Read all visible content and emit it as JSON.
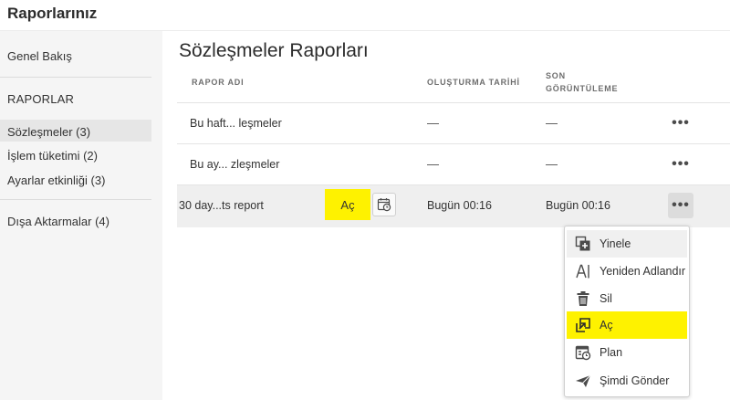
{
  "app": {
    "title": "Raporlarınız"
  },
  "sidebar": {
    "overview": "Genel Bakış",
    "section": "RAPORLAR",
    "items": [
      {
        "label": "Sözleşmeler (3)",
        "selected": true
      },
      {
        "label": "İşlem tüketimi (2)",
        "selected": false
      },
      {
        "label": "Ayarlar etkinliği (3)",
        "selected": false
      }
    ],
    "exports": "Dışa Aktarmalar (4)"
  },
  "main": {
    "title": "Sözleşmeler Raporları",
    "columns": {
      "name": "RAPOR ADI",
      "created": "OLUŞTURMA TARİHİ",
      "last_viewed_1": "SON",
      "last_viewed_2": "GÖRÜNTÜLEME"
    },
    "rows": [
      {
        "name": "Bu haft... leşmeler",
        "created": "—",
        "last_viewed": "—"
      },
      {
        "name": "Bu ay... zleşmeler",
        "created": "—",
        "last_viewed": "—"
      },
      {
        "name": "30 day...ts report",
        "created": "Bugün 00:16",
        "last_viewed": "Bugün 00:16",
        "open_label": "Aç"
      }
    ],
    "more_label": "•••"
  },
  "context_menu": {
    "items": [
      {
        "label": "Yinele",
        "icon": "duplicate-icon"
      },
      {
        "label": "Yeniden Adlandır",
        "icon": "rename-icon"
      },
      {
        "label": "Sil",
        "icon": "trash-icon"
      },
      {
        "label": "Aç",
        "icon": "open-icon"
      },
      {
        "label": "Plan",
        "icon": "schedule-icon"
      },
      {
        "label": "Şimdi Gönder",
        "icon": "send-icon"
      }
    ]
  },
  "colors": {
    "highlight": "#fef200",
    "sidebar_bg": "#f5f5f5"
  }
}
